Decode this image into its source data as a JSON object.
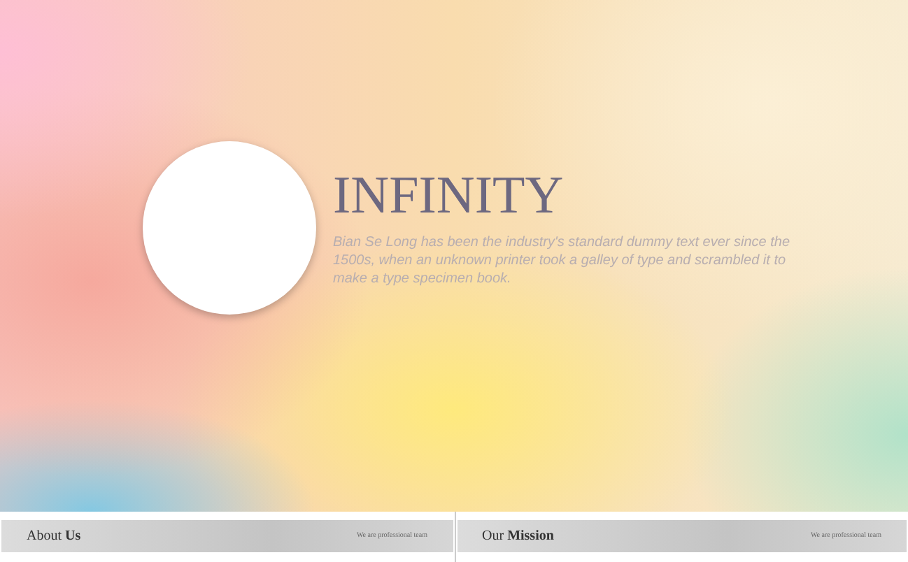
{
  "hero": {
    "title": "INFINITY",
    "description": "Bian Se Long  has been the industry's standard dummy text ever since the 1500s, when an unknown printer took a galley of type and scrambled it to make a type specimen book."
  },
  "sections": [
    {
      "label": "About **Us**",
      "tagline": "We are professional team"
    },
    {
      "label": "Our **Mission**",
      "tagline": "We are professional team"
    }
  ]
}
